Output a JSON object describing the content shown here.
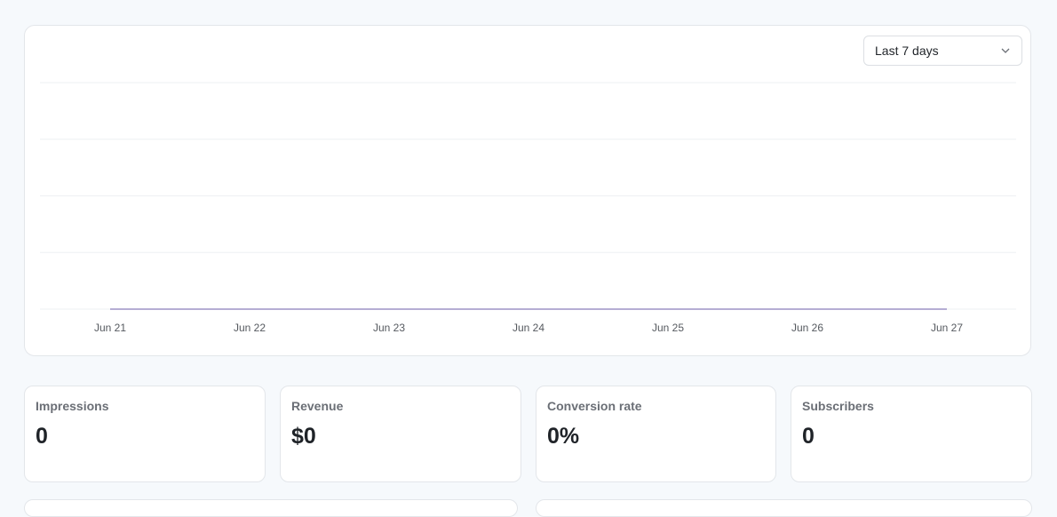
{
  "range_select": {
    "value": "Last 7 days",
    "icon": "chevron-down-icon"
  },
  "chart_data": {
    "type": "line",
    "x": [
      "Jun 21",
      "Jun 22",
      "Jun 23",
      "Jun 24",
      "Jun 25",
      "Jun 26",
      "Jun 27"
    ],
    "series": [
      {
        "values": [
          0,
          0,
          0,
          0,
          0,
          0,
          0
        ]
      }
    ],
    "grid": true,
    "title": "",
    "xlabel": "",
    "ylabel": "",
    "line_color": "#6b5ea8"
  },
  "stats": [
    {
      "label": "Impressions",
      "value": "0"
    },
    {
      "label": "Revenue",
      "value": "$0"
    },
    {
      "label": "Conversion rate",
      "value": "0%"
    },
    {
      "label": "Subscribers",
      "value": "0"
    }
  ]
}
